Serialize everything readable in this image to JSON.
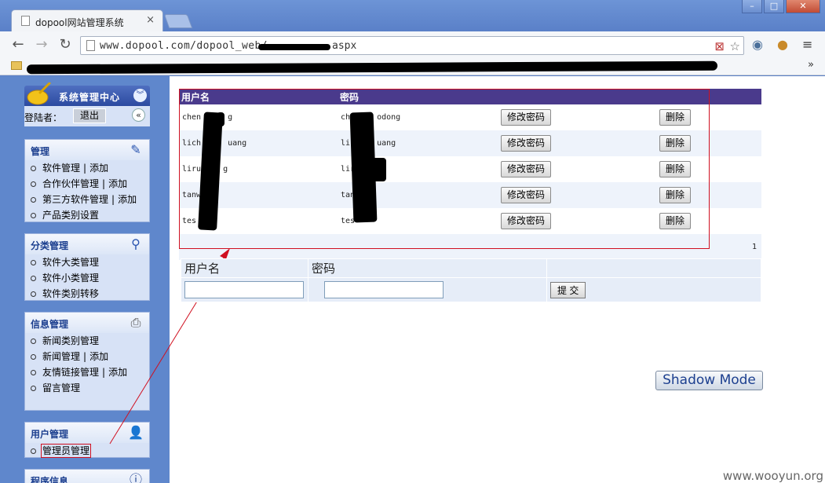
{
  "browser": {
    "tab_title": "dopool网站管理系统",
    "tab_close": "×",
    "url_prefix": "www.dopool.com/dopool_web/",
    "url_suffix": "aspx",
    "bookmark_more": "»",
    "window_controls": [
      "–",
      "□",
      "✕"
    ]
  },
  "sidebar": {
    "title": "系统管理中心",
    "login_label": "登陆者：",
    "logout": "退出",
    "panels": [
      {
        "title": "管理",
        "icon": "edit-icon",
        "items": [
          {
            "label": "软件管理",
            "extra": "添加"
          },
          {
            "label": "合作伙伴管理",
            "extra": "添加"
          },
          {
            "label": "第三方软件管理",
            "extra": "添加"
          },
          {
            "label": "产品类别设置"
          }
        ]
      },
      {
        "title": "分类管理",
        "icon": "search-icon",
        "items": [
          {
            "label": "软件大类管理"
          },
          {
            "label": "软件小类管理"
          },
          {
            "label": "软件类别转移"
          }
        ]
      },
      {
        "title": "信息管理",
        "icon": "printer-icon",
        "items": [
          {
            "label": "新闻类别管理"
          },
          {
            "label": "新闻管理",
            "extra": "添加"
          },
          {
            "label": "友情链接管理",
            "extra": "添加"
          },
          {
            "label": "留言管理"
          }
        ]
      },
      {
        "title": "用户管理",
        "icon": "user-icon",
        "items": [
          {
            "label": "管理员管理"
          }
        ]
      },
      {
        "title": "程序信息",
        "icon": "info-icon",
        "items": []
      }
    ],
    "separator": "|"
  },
  "users_table": {
    "headers": [
      "用户名",
      "密码"
    ],
    "rows": [
      {
        "username": "chen",
        "username_tail": "g",
        "password": "chen",
        "password_tail": "odong"
      },
      {
        "username": "lich",
        "username_tail": "uang",
        "password": "lic",
        "password_tail": "uang"
      },
      {
        "username": "liruo",
        "username_tail": "g",
        "password": "lir",
        "password_tail": ""
      },
      {
        "username": "tanw",
        "username_tail": "",
        "password": "tan",
        "password_tail": ""
      },
      {
        "username": "tes",
        "username_tail": "",
        "password": "tes",
        "password_tail": ""
      }
    ],
    "change_pwd_label": "修改密码",
    "delete_label": "删除",
    "page_number": "1"
  },
  "add_form": {
    "username_label": "用户名",
    "password_label": "密码",
    "submit_label": "提 交"
  },
  "shadow_mode": "Shadow Mode",
  "watermark": "www.wooyun.org"
}
